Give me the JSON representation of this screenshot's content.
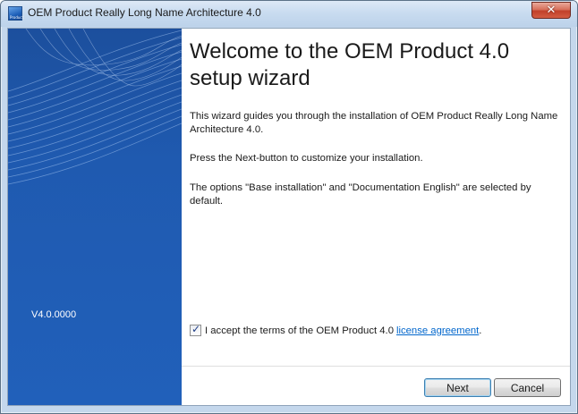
{
  "window": {
    "title": "OEM Product Really Long Name Architecture 4.0",
    "app_icon_text": "Product",
    "close_glyph": "✕"
  },
  "side_panel": {
    "version": "V4.0.0000"
  },
  "content": {
    "heading": "Welcome to the OEM Product 4.0 setup wizard",
    "paragraphs": [
      "This wizard guides you through the installation of OEM Product Really Long Name Architecture 4.0.",
      "Press the Next-button to customize your installation.",
      "The options \"Base installation\" and \"Documentation English\" are selected by default."
    ],
    "accept": {
      "checked": true,
      "check_glyph": "✓",
      "text": "I accept the terms of the OEM Product 4.0 ",
      "link_text": "license agreement",
      "suffix": "."
    }
  },
  "buttons": {
    "next": "Next",
    "cancel": "Cancel"
  },
  "colors": {
    "side_panel": "#2160ba",
    "link": "#0066cc",
    "close_button": "#c2412a"
  }
}
